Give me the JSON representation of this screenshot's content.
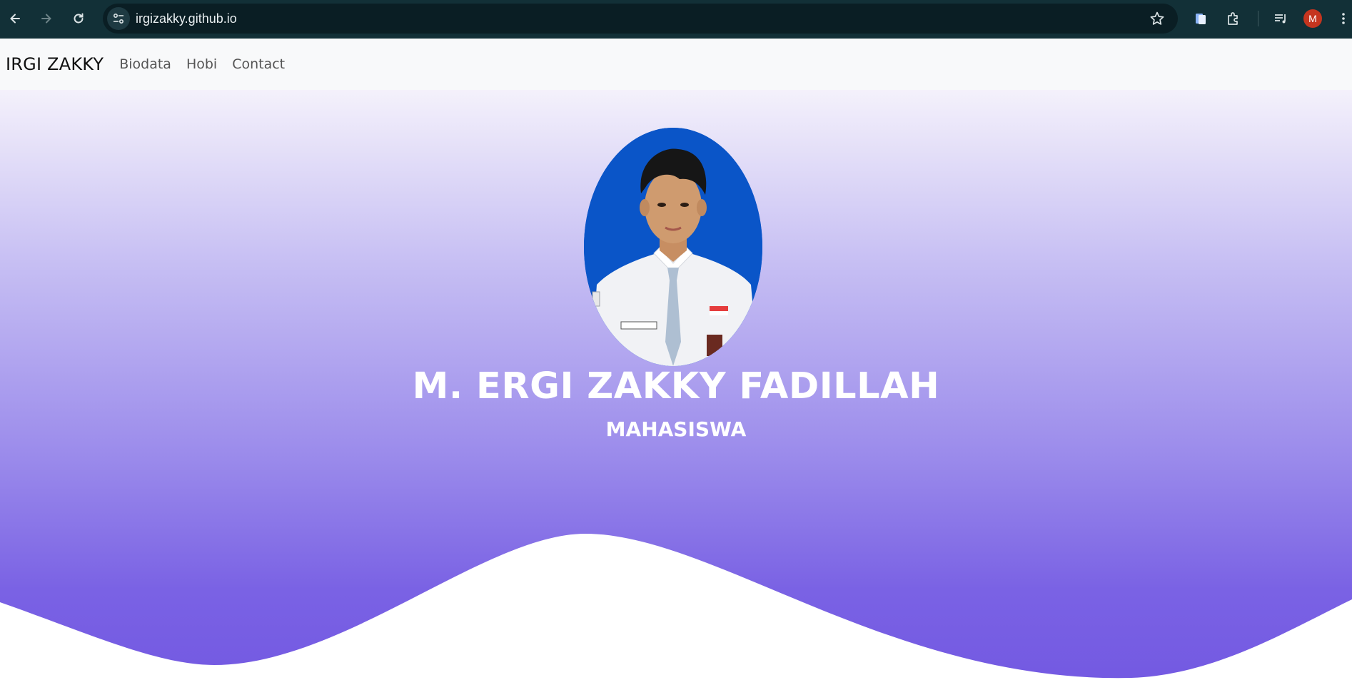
{
  "browser": {
    "url": "irgizakky.github.io",
    "profile_initial": "M",
    "icons": [
      "back-icon",
      "forward-icon",
      "reload-icon",
      "site-info-icon",
      "bookmark-star-icon",
      "document-icon",
      "extensions-icon",
      "media-control-icon",
      "more-menu-icon"
    ]
  },
  "site": {
    "brand": "IRGI ZAKKY",
    "nav": [
      "Biodata",
      "Hobi",
      "Contact"
    ]
  },
  "hero": {
    "name": "M. ERGI ZAKKY FADILLAH",
    "role": "MAHASISWA",
    "photo_background": "#0a55c8",
    "gradient_top": "#f4f1fb",
    "gradient_bottom": "#7359e2"
  }
}
